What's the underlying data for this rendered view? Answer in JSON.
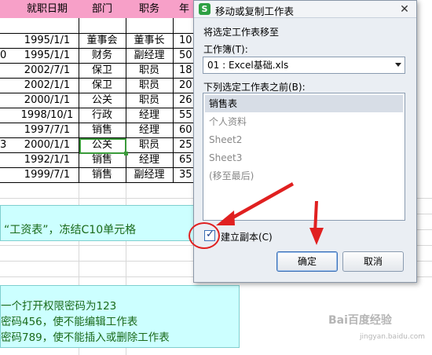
{
  "sheet": {
    "headers": [
      "",
      "就职日期",
      "部门",
      "职务",
      "年"
    ],
    "rows": [
      [
        "",
        "1995/1/1",
        "董事会",
        "董事长",
        "10"
      ],
      [
        "0",
        "1995/1/1",
        "财务",
        "副经理",
        "50"
      ],
      [
        "",
        "2002/7/1",
        "保卫",
        "职员",
        "18"
      ],
      [
        "",
        "2002/1/1",
        "保卫",
        "职员",
        "20"
      ],
      [
        "",
        "2000/1/1",
        "公关",
        "职员",
        "26"
      ],
      [
        "",
        "1998/10/1",
        "行政",
        "经理",
        "55"
      ],
      [
        "",
        "1997/7/1",
        "销售",
        "经理",
        "60"
      ],
      [
        "3",
        "2000/1/1",
        "公关",
        "职员",
        "25"
      ],
      [
        "",
        "1992/1/1",
        "销售",
        "经理",
        "65"
      ],
      [
        "",
        "1999/7/1",
        "销售",
        "副经理",
        "35"
      ]
    ],
    "note1": "“工资表”，冻结C10单元格",
    "note2": [
      "一个打开权限密码为123",
      "密码456，使不能编辑工作表",
      "密码789，使不能插入或删除工作表"
    ]
  },
  "dialog": {
    "icon": "S",
    "title": "移动或复制工作表",
    "close_label": "✕",
    "move_to_label": "将选定工作表移至",
    "workbook_label": "工作簿(T):",
    "workbook_value": "01 : Excel基础.xls",
    "before_label": "下列选定工作表之前(B):",
    "sheets": [
      "销售表",
      "个人资料",
      "Sheet2",
      "Sheet3",
      "(移至最后)"
    ],
    "selected_sheet": "销售表",
    "copy_label": "建立副本(C)",
    "copy_checked": true,
    "ok_label": "确定",
    "cancel_label": "取消"
  },
  "watermark": {
    "text": "Bai百度经验",
    "sub": "jingyan.baidu.com"
  },
  "colors": {
    "header_bg": "#f7a0c8",
    "note_bg": "#ccffff",
    "annotation": "#e02020",
    "selection": "#3a9a3a"
  }
}
